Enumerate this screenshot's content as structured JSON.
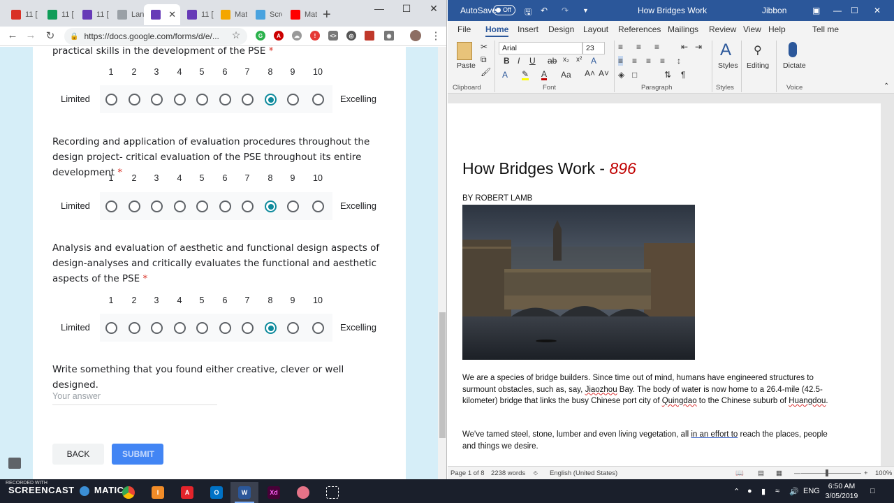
{
  "chrome": {
    "tabs": [
      {
        "label": "11 [",
        "favicon": "gmail-icon",
        "color": "#d93025"
      },
      {
        "label": "11 [",
        "favicon": "sheets-icon",
        "color": "#0f9d58"
      },
      {
        "label": "11 [",
        "favicon": "forms-icon",
        "color": "#673ab7"
      },
      {
        "label": "Lan",
        "favicon": "puzzle-icon",
        "color": "#9aa0a6"
      },
      {
        "label": "",
        "favicon": "forms-icon",
        "color": "#673ab7"
      },
      {
        "label": "11 [",
        "favicon": "forms-icon",
        "color": "#673ab7"
      },
      {
        "label": "Mat",
        "favicon": "mathletics-icon",
        "color": "#f4a600"
      },
      {
        "label": "Scre",
        "favicon": "screencast-icon",
        "color": "#4aa3df"
      },
      {
        "label": "Mat",
        "favicon": "youtube-icon",
        "color": "#ff0000"
      }
    ],
    "url": "https://docs.google.com/forms/d/e/...",
    "form": {
      "q0_tail": "practical skills in the development of the PSE",
      "scale_numbers": [
        "1",
        "2",
        "3",
        "4",
        "5",
        "6",
        "7",
        "8",
        "9",
        "10"
      ],
      "low_label": "Limited",
      "high_label": "Excelling",
      "required_mark": "*",
      "q1": "Recording and application of evaluation procedures throughout the design project- critical evaluation of the PSE throughout its entire development",
      "q2": "Analysis and evaluation of aesthetic and functional design aspects of design-analyses and critically evaluates the functional and aesthetic aspects of the PSE",
      "q3": "Write something that you found either creative, clever or well designed.",
      "answer_placeholder": "Your answer",
      "selected_values": [
        8,
        8,
        8
      ],
      "back_label": "BACK",
      "submit_label": "SUBMIT"
    }
  },
  "word": {
    "autosave_label": "AutoSave",
    "autosave_state": "Off",
    "doc_title": "How Bridges Work",
    "user": "Jibbon",
    "menu": [
      "File",
      "Home",
      "Insert",
      "Design",
      "Layout",
      "References",
      "Mailings",
      "Review",
      "View",
      "Help",
      "Tell me"
    ],
    "ribbon": {
      "font_name": "Arial",
      "font_size": "23",
      "paste_label": "Paste",
      "clipboard_label": "Clipboard",
      "font_label": "Font",
      "paragraph_label": "Paragraph",
      "styles_label": "Styles",
      "styles_group_label": "Styles",
      "editing_label": "Editing",
      "dictate_label": "Dictate",
      "voice_label": "Voice"
    },
    "document": {
      "title": "How Bridges Work  - ",
      "title_number": "896",
      "byline": "BY ROBERT LAMB",
      "para1_a": "We are a species of bridge builders. Since time out of mind, humans have engineered structures to surmount obstacles, such as, say, ",
      "para1_b": "Jiaozhou",
      "para1_c": " Bay. The body of water is now home to a 26.4-mile (42.5-kilometer) bridge that links the busy Chinese port city of ",
      "para1_d": "Quingdao",
      "para1_e": " to the Chinese suburb of ",
      "para1_f": "Huangdou",
      "para1_g": ".",
      "para2_a": "We've tamed steel, stone, lumber and even living vegetation, all ",
      "para2_b": "in an effort to",
      "para2_c": " reach the places, people and things we desire."
    },
    "status": {
      "page": "Page 1 of 8",
      "words": "2238 words",
      "language": "English (United States)",
      "zoom": "100%"
    }
  },
  "taskbar": {
    "recorded_with": "RECORDED WITH",
    "screencast": "SCREENCAST",
    "matic": "MATIC",
    "lang": "ENG",
    "time": "6:50 AM",
    "date": "3/05/2019"
  }
}
